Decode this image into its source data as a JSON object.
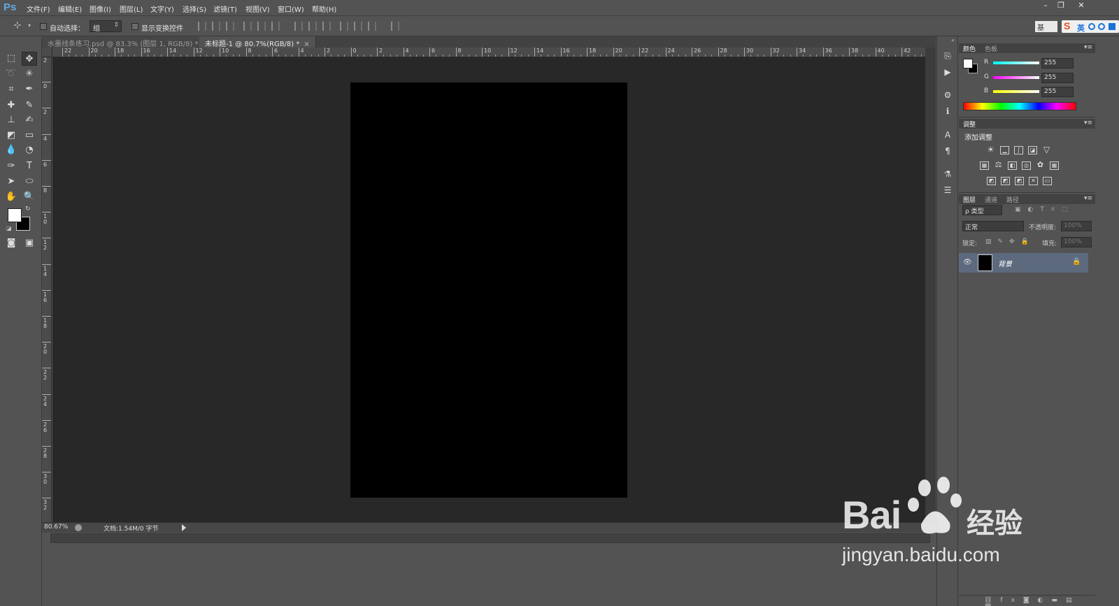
{
  "app": {
    "logo": "Ps"
  },
  "menu": [
    {
      "label": "文件(F)"
    },
    {
      "label": "编辑(E)"
    },
    {
      "label": "图像(I)"
    },
    {
      "label": "图层(L)"
    },
    {
      "label": "文字(Y)"
    },
    {
      "label": "选择(S)"
    },
    {
      "label": "滤镜(T)"
    },
    {
      "label": "视图(V)"
    },
    {
      "label": "窗口(W)"
    },
    {
      "label": "帮助(H)"
    }
  ],
  "options": {
    "auto_select_label": "自动选择：",
    "auto_select_value": "组",
    "show_transform_label": "显示变换控件",
    "workspace_label": "基"
  },
  "ime": {
    "lang": "英"
  },
  "tabs": [
    {
      "label": "水墨线条练习.psd @ 83.3% (图层 1, RGB/8) *",
      "close": "×"
    },
    {
      "label": "未标题-1 @ 80.7%(RGB/8) *",
      "close": "×"
    }
  ],
  "ruler": {
    "h_labels": [
      "22",
      "20",
      "18",
      "16",
      "14",
      "12",
      "10",
      "8",
      "6",
      "4",
      "2",
      "0",
      "2",
      "4",
      "6",
      "8",
      "10",
      "12",
      "14",
      "16",
      "18",
      "20",
      "22",
      "24",
      "26",
      "28",
      "30",
      "32",
      "34",
      "36",
      "38",
      "40",
      "42"
    ],
    "v_labels": [
      "2",
      "0",
      "2",
      "4",
      "6",
      "8",
      "10",
      "12",
      "14",
      "16",
      "18",
      "20",
      "22",
      "24",
      "26",
      "28",
      "30",
      "32"
    ]
  },
  "status": {
    "zoom": "80.67%",
    "doc": "文档:1.54M/0 字节"
  },
  "color_panel": {
    "tabs": [
      "颜色",
      "色板"
    ],
    "channels": [
      {
        "label": "R",
        "value": "255",
        "gradient": "linear-gradient(to right,#00ffff,#ffffff)"
      },
      {
        "label": "G",
        "value": "255",
        "gradient": "linear-gradient(to right,#ff00ff,#ffffff)"
      },
      {
        "label": "B",
        "value": "255",
        "gradient": "linear-gradient(to right,#ffff00,#ffffff)"
      }
    ]
  },
  "adjust_panel": {
    "tab": "调整",
    "title": "添加调整"
  },
  "layers_panel": {
    "tabs": [
      "图层",
      "通道",
      "路径"
    ],
    "filter": "ρ 类型",
    "blend": "正常",
    "opacity_label": "不透明度:",
    "opacity_value": "100%",
    "lock_label": "锁定:",
    "fill_label": "填充:",
    "fill_value": "100%",
    "layers": [
      {
        "name": "背景"
      }
    ]
  },
  "watermark": {
    "brand": "Bai",
    "cn": "经验",
    "url": "jingyan.baidu.com"
  },
  "colors": {
    "fg": "#ffffff",
    "bg": "#000000",
    "canvas": "#000000",
    "workspace": "#282828",
    "accent": "#5fa9e3"
  }
}
